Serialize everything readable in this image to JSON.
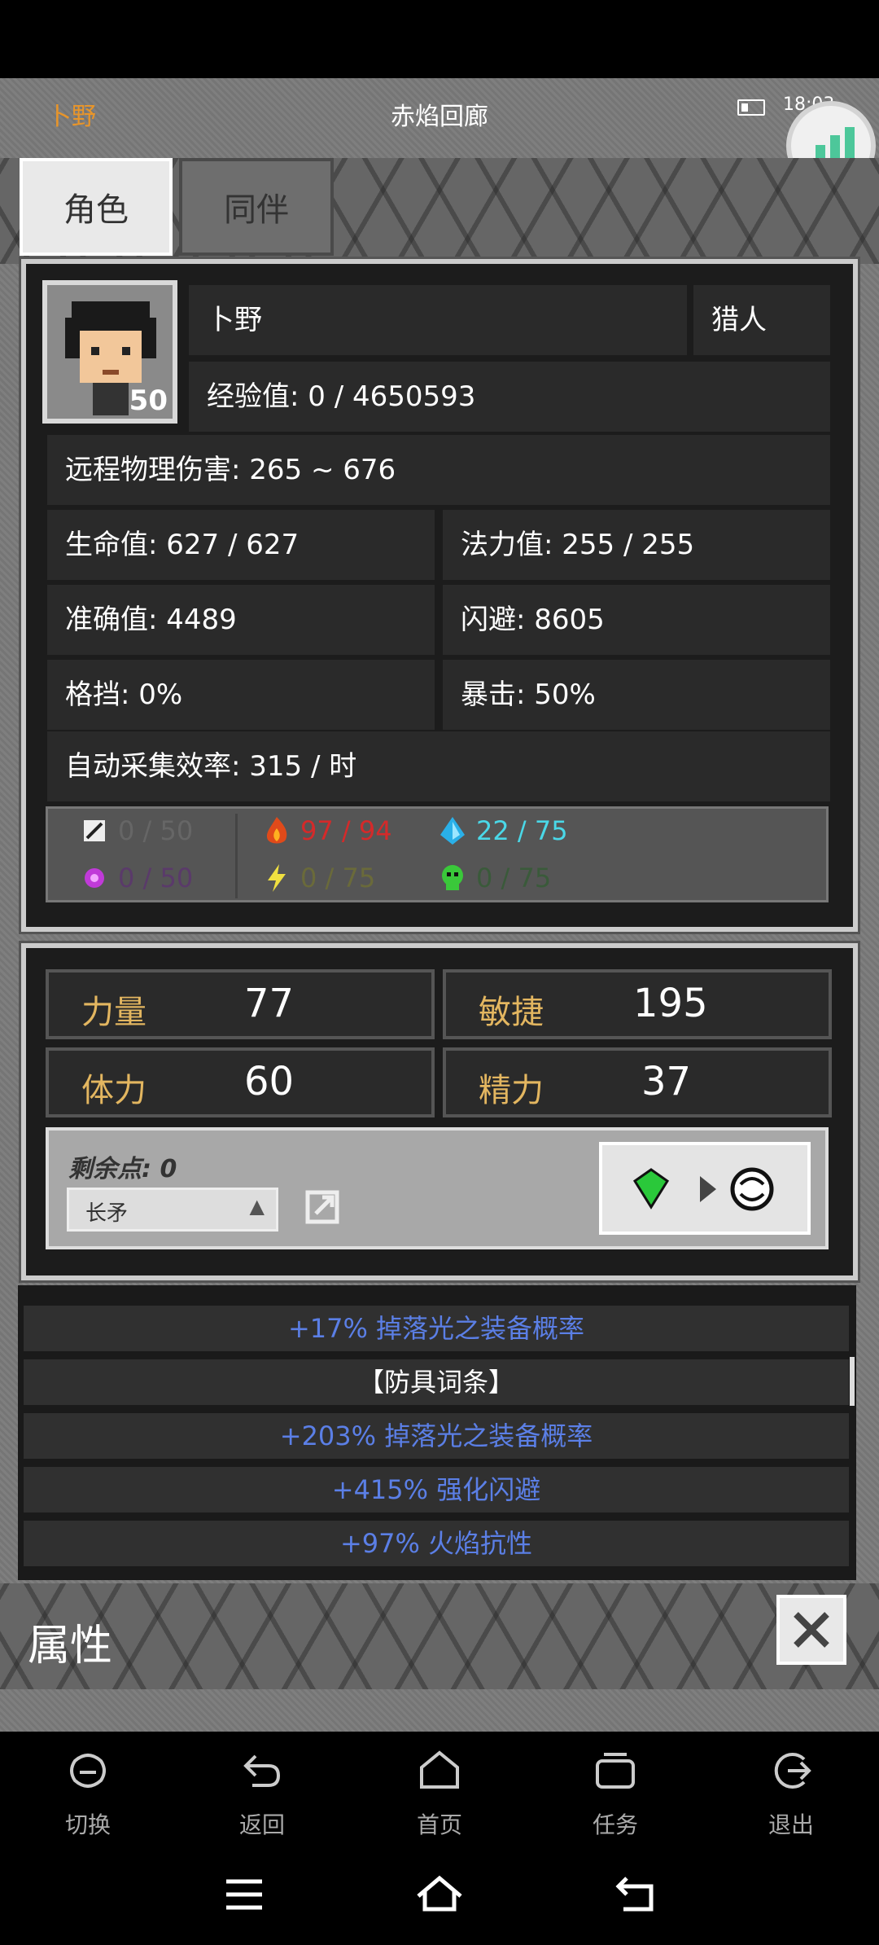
{
  "status": {
    "player_name": "卜野",
    "area": "赤焰回廊",
    "time": "18:03"
  },
  "tabs": [
    {
      "label": "角色"
    },
    {
      "label": "同伴"
    }
  ],
  "character": {
    "level": "50",
    "name": "卜野",
    "class": "猎人",
    "exp": "经验值: 0 / 4650593",
    "damage": "远程物理伤害: 265 ~ 676",
    "hp": "生命值: 627 / 627",
    "mp": "法力值: 255 / 255",
    "accuracy": "准确值: 4489",
    "dodge": "闪避: 8605",
    "block": "格挡: 0%",
    "crit": "暴击: 50%",
    "gather": "自动采集效率: 315 / 时",
    "resistances": [
      {
        "icon": "physical-resist-icon",
        "text": "0 / 50",
        "color": "#666666"
      },
      {
        "icon": "fire-resist-icon",
        "text": "97 / 94",
        "color": "#d42a2a"
      },
      {
        "icon": "ice-resist-icon",
        "text": "22 / 75",
        "color": "#4ad8e8"
      },
      {
        "icon": "arcane-resist-icon",
        "text": "0 / 50",
        "color": "#5a3a6a"
      },
      {
        "icon": "lightning-resist-icon",
        "text": "0 / 75",
        "color": "#6a6a3a"
      },
      {
        "icon": "poison-resist-icon",
        "text": "0 / 75",
        "color": "#3a5a3a"
      }
    ]
  },
  "attributes": [
    {
      "label": "力量",
      "value": "77"
    },
    {
      "label": "敏捷",
      "value": "195"
    },
    {
      "label": "体力",
      "value": "60"
    },
    {
      "label": "精力",
      "value": "37"
    }
  ],
  "points": {
    "remaining": "剩余点: 0",
    "weapon_select": "长矛"
  },
  "affixes": [
    {
      "text": "+17% 掉落光之装备概率",
      "color": "#5b7fe6"
    },
    {
      "text": "【防具词条】",
      "color": "#ffffff"
    },
    {
      "text": "+203% 掉落光之装备概率",
      "color": "#5b7fe6"
    },
    {
      "text": "+415% 强化闪避",
      "color": "#5b7fe6"
    },
    {
      "text": "+97% 火焰抗性",
      "color": "#5b7fe6"
    }
  ],
  "footer": {
    "title": "属性"
  },
  "nav": [
    {
      "label": "切换",
      "icon": "switch-icon"
    },
    {
      "label": "返回",
      "icon": "back-icon"
    },
    {
      "label": "首页",
      "icon": "home-icon"
    },
    {
      "label": "任务",
      "icon": "tasks-icon"
    },
    {
      "label": "退出",
      "icon": "exit-icon"
    }
  ]
}
